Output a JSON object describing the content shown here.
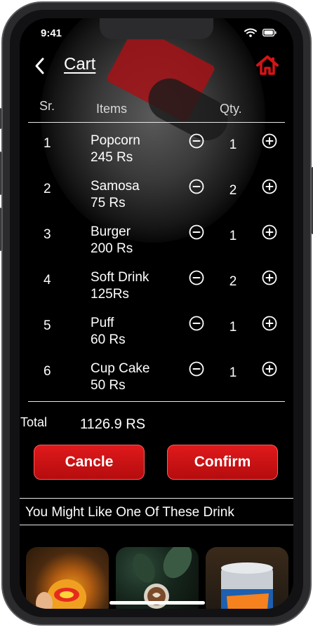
{
  "status": {
    "time": "9:41"
  },
  "header": {
    "title": "Cart"
  },
  "columns": {
    "sr": "Sr.",
    "items": "Items",
    "qty": "Qty."
  },
  "items": [
    {
      "sr": "1",
      "name": "Popcorn",
      "price": "245 Rs",
      "qty": "1"
    },
    {
      "sr": "2",
      "name": "Samosa",
      "price": "75 Rs",
      "qty": "2"
    },
    {
      "sr": "3",
      "name": "Burger",
      "price": "200 Rs",
      "qty": "1"
    },
    {
      "sr": "4",
      "name": "Soft Drink",
      "price": "125Rs",
      "qty": "2"
    },
    {
      "sr": "5",
      "name": "Puff",
      "price": "60 Rs",
      "qty": "1"
    },
    {
      "sr": "6",
      "name": "Cup Cake",
      "price": "50 Rs",
      "qty": "1"
    }
  ],
  "total": {
    "label": "Total",
    "value": "1126.9 RS"
  },
  "buttons": {
    "cancel": "Cancle",
    "confirm": "Confirm"
  },
  "suggestions": {
    "heading": "You Might Like One Of These Drink",
    "thumbnails": [
      "chupa-chups-drink",
      "coffee-drink",
      "fanta-drink"
    ]
  },
  "colors": {
    "accent": "#d41416",
    "background": "#000000",
    "text": "#ffffff"
  }
}
